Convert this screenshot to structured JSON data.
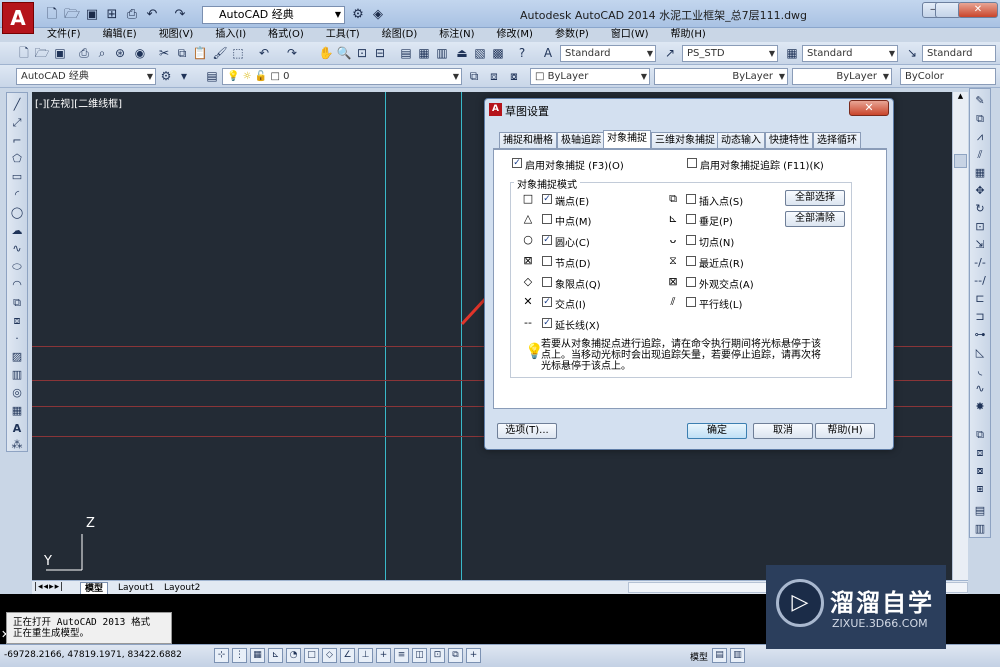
{
  "window": {
    "workspace": "AutoCAD 经典",
    "title": "Autodesk AutoCAD 2014    水泥工业框架_总7层111.dwg",
    "controls": [
      "—",
      "□",
      "✕"
    ]
  },
  "menu": [
    "文件(F)",
    "编辑(E)",
    "视图(V)",
    "插入(I)",
    "格式(O)",
    "工具(T)",
    "绘图(D)",
    "标注(N)",
    "修改(M)",
    "参数(P)",
    "窗口(W)",
    "帮助(H)"
  ],
  "toolbar2": {
    "text_style": "Standard",
    "dim_style": "PS_STD",
    "table_style": "Standard",
    "mleader_style": "Standard"
  },
  "toolbar3": {
    "workspace": "AutoCAD 经典",
    "layer": "0",
    "color": "ByLayer",
    "linetype": "ByLayer",
    "lineweight": "ByLayer",
    "plotstyle": "ByColor"
  },
  "canvas": {
    "viewport_label": "[-][左视][二维线框]",
    "ucs_z": "Z",
    "ucs_y": "Y"
  },
  "tabs": [
    "模型",
    "Layout1",
    "Layout2"
  ],
  "command": {
    "lines": [
      "正在打开 AutoCAD 2013 格式",
      "正在重生成模型。"
    ],
    "close": "✕"
  },
  "status": {
    "coords": "-69728.2166, 47819.1971, 83422.6882",
    "model": "模型"
  },
  "dialog": {
    "title": "草图设置",
    "tabs": [
      "捕捉和栅格",
      "极轴追踪",
      "对象捕捉",
      "三维对象捕捉",
      "动态输入",
      "快捷特性",
      "选择循环"
    ],
    "active_tab": 2,
    "enable_osnap": "启用对象捕捉 (F3)(O)",
    "enable_tracking": "启用对象捕捉追踪 (F11)(K)",
    "group_title": "对象捕捉模式",
    "left_modes": [
      {
        "symbol": "□",
        "label": "端点(E)",
        "checked": true
      },
      {
        "symbol": "△",
        "label": "中点(M)",
        "checked": false
      },
      {
        "symbol": "○",
        "label": "圆心(C)",
        "checked": true
      },
      {
        "symbol": "⊠",
        "label": "节点(D)",
        "checked": false
      },
      {
        "symbol": "◇",
        "label": "象限点(Q)",
        "checked": false
      },
      {
        "symbol": "✕",
        "label": "交点(I)",
        "checked": true
      },
      {
        "symbol": "--",
        "label": "延长线(X)",
        "checked": true
      }
    ],
    "right_modes": [
      {
        "symbol": "⧉",
        "label": "插入点(S)",
        "checked": false
      },
      {
        "symbol": "⊾",
        "label": "垂足(P)",
        "checked": false
      },
      {
        "symbol": "ᴗ",
        "label": "切点(N)",
        "checked": false
      },
      {
        "symbol": "⧖",
        "label": "最近点(R)",
        "checked": false
      },
      {
        "symbol": "⊠",
        "label": "外观交点(A)",
        "checked": false
      },
      {
        "symbol": "⫽",
        "label": "平行线(L)",
        "checked": false
      }
    ],
    "select_all": "全部选择",
    "clear_all": "全部清除",
    "tip": "若要从对象捕捉点进行追踪，请在命令执行期间将光标悬停于该点上。当移动光标时会出现追踪矢量，若要停止追踪，请再次将光标悬停于该点上。",
    "options": "选项(T)...",
    "ok": "确定",
    "cancel": "取消",
    "help": "帮助(H)"
  },
  "watermark": {
    "name": "溜溜自学",
    "url": "ZIXUE.3D66.COM"
  },
  "colors": {
    "canvas_bg": "#232b35",
    "cyan_line": "#39b8c8",
    "red_line": "#8a3538",
    "arrow": "#e0342a"
  }
}
